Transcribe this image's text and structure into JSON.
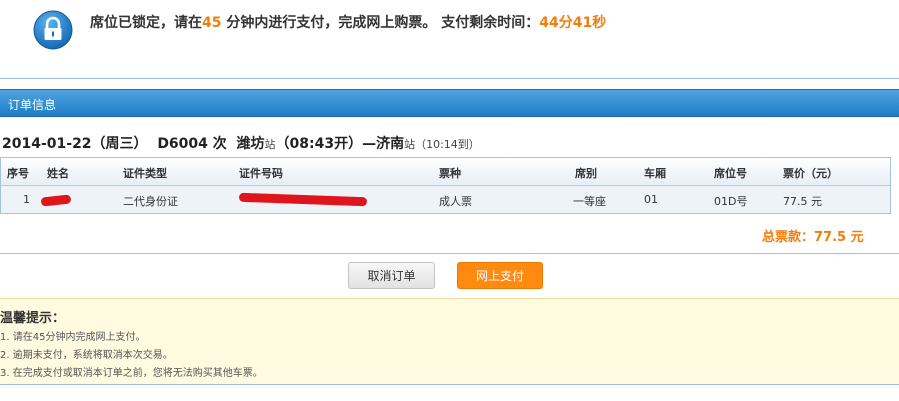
{
  "notice": {
    "part1": "席位已锁定，请在",
    "minutes": "45",
    "part2": " 分钟内进行支付，完成网上购票。 支付剩余时间：",
    "remaining": "44分41秒"
  },
  "colors": {
    "accent": "#f27d0e",
    "header_bar": "#1f7cc6",
    "pay_button": "#ff8a10",
    "tips_bg": "#fffae0"
  },
  "order_section": {
    "title": "订单信息"
  },
  "train": {
    "date": "2014-01-22（周三）",
    "number": "D6004 次",
    "from": "潍坊",
    "from_suffix": "站",
    "departure": "（08:43开）",
    "dash": "—",
    "to": "济南",
    "to_suffix": "站",
    "arrival": "（10:14到）"
  },
  "table": {
    "headers": [
      "序号",
      "姓名",
      "证件类型",
      "证件号码",
      "票种",
      "席别",
      "车厢",
      "席位号",
      "票价（元）"
    ],
    "rows": [
      {
        "index": "1",
        "id_type": "二代身份证",
        "ticket_type": "成人票",
        "seat_class": "一等座",
        "car": "01",
        "seat": "01D号",
        "price": "77.5 元"
      }
    ]
  },
  "total": "总票款：77.5 元",
  "buttons": {
    "cancel": "取消订单",
    "pay": "网上支付"
  },
  "tips": {
    "title": "温馨提示：",
    "items": [
      "1. 请在45分钟内完成网上支付。",
      "2. 逾期未支付，系统将取消本次交易。",
      "3. 在完成支付或取消本订单之前，您将无法购买其他车票。"
    ]
  },
  "icons": {
    "lock": "lock-icon"
  }
}
